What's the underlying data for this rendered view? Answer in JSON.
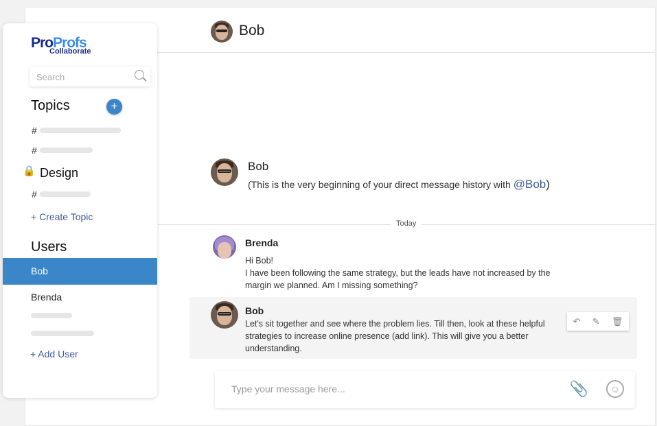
{
  "logo": {
    "brand_a": "Pro",
    "brand_b": "Profs",
    "product": "Collaborate"
  },
  "sidebar": {
    "search_placeholder": "Search",
    "topics_heading": "Topics",
    "add_topic": "+",
    "topic_prefix": "#",
    "design_heading": "Design",
    "create_topic": "+ Create Topic",
    "users_heading": "Users",
    "users": [
      {
        "label": "Bob",
        "active": true
      },
      {
        "label": "Brenda",
        "active": false
      }
    ],
    "add_user": "+ Add User"
  },
  "header": {
    "title": "Bob"
  },
  "intro": {
    "name": "Bob",
    "text": "(This is the very beginning of your direct message history with ",
    "mention": "@Bob",
    "end": ")"
  },
  "divider_label": "Today",
  "messages": [
    {
      "author": "Brenda",
      "lines": [
        "Hi Bob!",
        "I have been following the same strategy, but the leads have not increased by the",
        "margin we planned. Am I missing something?"
      ]
    },
    {
      "author": "Bob",
      "lines": [
        "Let's sit together and see where the problem lies. Till then, look at these helpful",
        "strategies to increase online presence (add link). This will give you a better",
        "understanding."
      ]
    }
  ],
  "message_actions": {
    "reply": "reply-icon",
    "edit": "pencil-icon",
    "delete": "trash-icon"
  },
  "composer": {
    "placeholder": "Type your message here..."
  },
  "colors": {
    "accent": "#3a86c8",
    "link": "#3d5a9e"
  }
}
